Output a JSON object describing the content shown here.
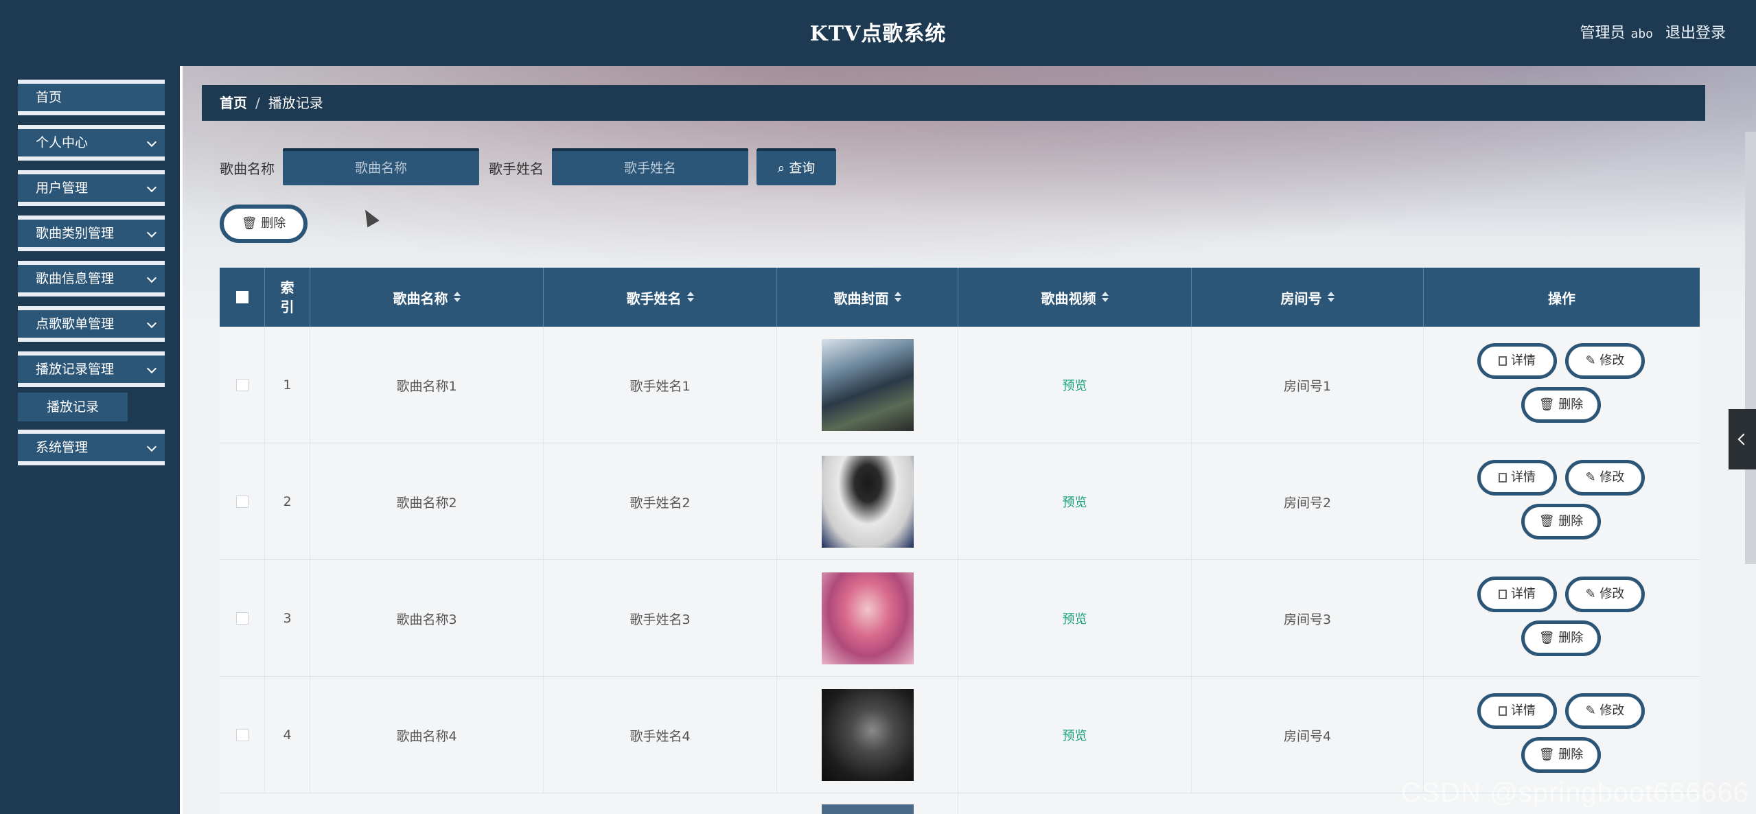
{
  "header": {
    "title": "KTV点歌系统",
    "role_label": "管理员",
    "username": "abo",
    "logout_label": "退出登录"
  },
  "sidebar": {
    "items": [
      {
        "label": "首页"
      },
      {
        "label": "个人中心"
      },
      {
        "label": "用户管理"
      },
      {
        "label": "歌曲类别管理"
      },
      {
        "label": "歌曲信息管理"
      },
      {
        "label": "点歌歌单管理"
      },
      {
        "label": "播放记录管理"
      },
      {
        "label": "系统管理"
      }
    ],
    "sub_item": "播放记录"
  },
  "breadcrumb": {
    "home": "首页",
    "separator": "/",
    "current": "播放记录"
  },
  "search": {
    "song_label": "歌曲名称",
    "song_placeholder": "歌曲名称",
    "singer_label": "歌手姓名",
    "singer_placeholder": "歌手姓名",
    "query_label": "查询"
  },
  "bulk_delete_label": "删除",
  "table": {
    "headers": {
      "index": "索引",
      "song": "歌曲名称",
      "singer": "歌手姓名",
      "cover": "歌曲封面",
      "video": "歌曲视频",
      "room": "房间号",
      "ops": "操作"
    },
    "rows": [
      {
        "index": "1",
        "song": "歌曲名称1",
        "singer": "歌手姓名1",
        "video": "预览",
        "room": "房间号1"
      },
      {
        "index": "2",
        "song": "歌曲名称2",
        "singer": "歌手姓名2",
        "video": "预览",
        "room": "房间号2"
      },
      {
        "index": "3",
        "song": "歌曲名称3",
        "singer": "歌手姓名3",
        "video": "预览",
        "room": "房间号3"
      },
      {
        "index": "4",
        "song": "歌曲名称4",
        "singer": "歌手姓名4",
        "video": "预览",
        "room": "房间号4"
      }
    ],
    "op_labels": {
      "detail": "详情",
      "edit": "修改",
      "delete": "删除"
    }
  },
  "watermark": "CSDN @springboot666666",
  "colors": {
    "header_bg": "#1e3a52",
    "accent": "#2c5678",
    "preview_link": "#1aa37a"
  }
}
